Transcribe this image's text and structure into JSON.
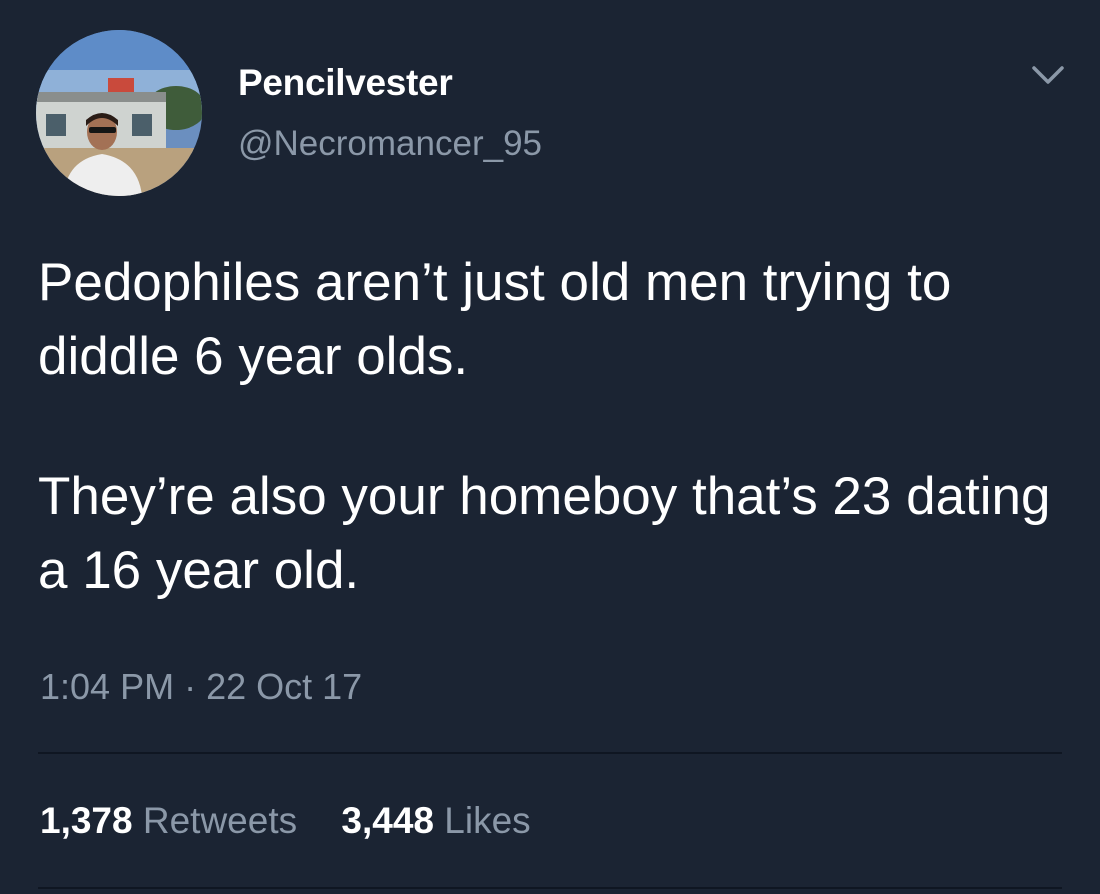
{
  "author": {
    "display_name": "Pencilvester",
    "handle": "@Necromancer_95",
    "avatar_icon": "profile-photo"
  },
  "tweet": {
    "paragraphs": [
      "Pedophiles aren’t just old men trying to diddle 6 year olds.",
      "They’re also your homeboy that’s 23 dating a 16 year old."
    ],
    "time": "1:04 PM",
    "separator": "·",
    "date": "22 Oct 17"
  },
  "stats": {
    "retweets_count": "1,378",
    "retweets_label": "Retweets",
    "likes_count": "3,448",
    "likes_label": "Likes"
  },
  "icons": {
    "menu": "chevron-down-icon"
  },
  "colors": {
    "background": "#1b2433",
    "text_primary": "#ffffff",
    "text_secondary": "#8b98a8"
  }
}
